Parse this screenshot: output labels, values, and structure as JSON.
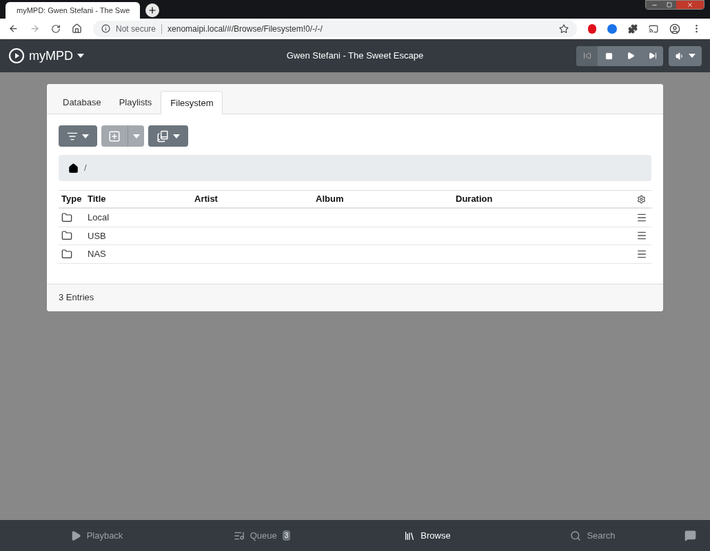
{
  "browser": {
    "tab_title": "myMPD: Gwen Stefani - The Swe",
    "security": "Not secure",
    "url": "xenomaipi.local/#/Browse/Filesystem!0/-/-/"
  },
  "navbar": {
    "brand": "myMPD",
    "now_playing": "Gwen Stefani - The Sweet Escape"
  },
  "tabs": [
    {
      "label": "Database",
      "selected": false
    },
    {
      "label": "Playlists",
      "selected": false
    },
    {
      "label": "Filesystem",
      "selected": true
    }
  ],
  "toolbar": [
    {
      "kind": "filter",
      "disabled": false
    },
    {
      "kind": "add",
      "disabled": true
    },
    {
      "kind": "bookmark",
      "disabled": false
    }
  ],
  "breadcrumb": {
    "separator": "/"
  },
  "table": {
    "columns": [
      "Type",
      "Title",
      "Artist",
      "Album",
      "Duration"
    ],
    "rows": [
      {
        "title": "Local"
      },
      {
        "title": "USB"
      },
      {
        "title": "NAS"
      }
    ]
  },
  "footer": "3 Entries",
  "bottom_nav": [
    {
      "kind": "playback",
      "label": "Playback",
      "selected": false
    },
    {
      "kind": "queue",
      "label": "Queue",
      "badge": "3",
      "selected": false
    },
    {
      "kind": "browse",
      "label": "Browse",
      "selected": true
    },
    {
      "kind": "search",
      "label": "Search",
      "selected": false
    }
  ]
}
